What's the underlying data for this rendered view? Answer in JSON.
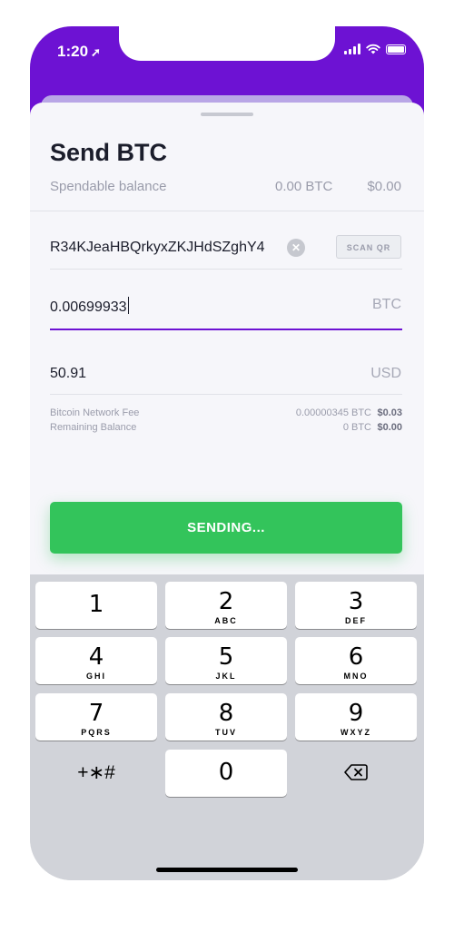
{
  "status_bar": {
    "time": "1:20",
    "location_arrow": "➚"
  },
  "sheet": {
    "title": "Send BTC",
    "balance_label": "Spendable balance",
    "balance_btc": "0.00 BTC",
    "balance_usd": "$0.00"
  },
  "form": {
    "address": "R34KJeaHBQrkyxZKJHdSZghY4",
    "scan_label": "SCAN QR",
    "amount": "0.00699933",
    "amount_unit": "BTC",
    "fiat_amount": "50.91",
    "fiat_unit": "USD"
  },
  "fees": {
    "fee_label": "Bitcoin Network Fee",
    "fee_btc": "0.00000345 BTC",
    "fee_usd": "$0.03",
    "remaining_label": "Remaining Balance",
    "remaining_btc": "0 BTC",
    "remaining_usd": "$0.00"
  },
  "send_button": "SENDING...",
  "keypad": {
    "k1": "1",
    "k2": "2",
    "k2_sub": "ABC",
    "k3": "3",
    "k3_sub": "DEF",
    "k4": "4",
    "k4_sub": "GHI",
    "k5": "5",
    "k5_sub": "JKL",
    "k6": "6",
    "k6_sub": "MNO",
    "k7": "7",
    "k7_sub": "PQRS",
    "k8": "8",
    "k8_sub": "TUV",
    "k9": "9",
    "k9_sub": "WXYZ",
    "k0": "0",
    "symbols": "+∗#"
  },
  "colors": {
    "brand_purple": "#6d12d3",
    "send_green": "#33c45b"
  }
}
